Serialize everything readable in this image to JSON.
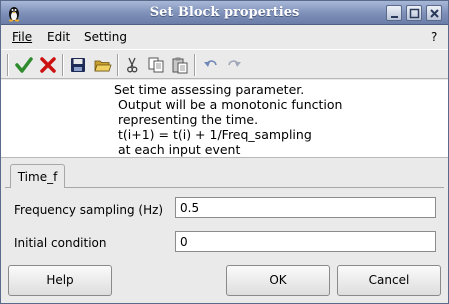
{
  "window": {
    "title": "Set Block properties",
    "help_char": "?"
  },
  "menu": {
    "file": "File",
    "edit": "Edit",
    "setting": "Setting"
  },
  "toolbar": {
    "icons": [
      "ok-check-icon",
      "cancel-x-icon",
      "save-icon",
      "open-folder-icon",
      "cut-icon",
      "copy-icon",
      "paste-icon",
      "undo-icon",
      "redo-icon"
    ]
  },
  "description": {
    "lines": [
      "Set time assessing parameter.",
      " Output will be a monotonic function",
      " representing the time.",
      " t(i+1) = t(i) + 1/Freq_sampling",
      " at each input event"
    ]
  },
  "tab": {
    "label": "Time_f"
  },
  "fields": {
    "frequency": {
      "label": "Frequency sampling (Hz)",
      "value": "0.5"
    },
    "initial": {
      "label": "Initial condition",
      "value": "0"
    }
  },
  "buttons": {
    "help": "Help",
    "ok": "OK",
    "cancel": "Cancel"
  },
  "colors": {
    "titlebar": "#7d8fb8",
    "ok_green": "#2e8b2e",
    "cancel_red": "#cc1111"
  }
}
